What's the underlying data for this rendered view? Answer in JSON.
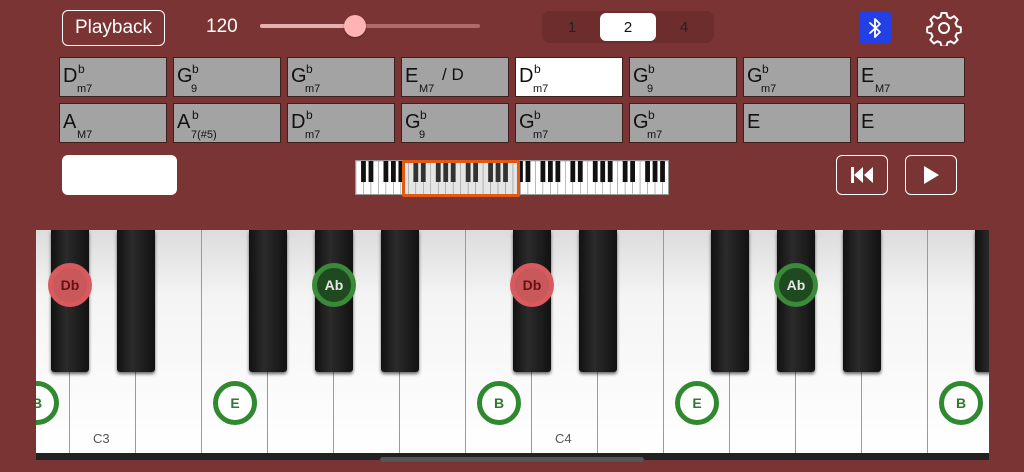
{
  "toolbar": {
    "playback_label": "Playback",
    "tempo_value": "120",
    "tempo_fraction": 0.43,
    "segments": [
      "1",
      "2",
      "4"
    ],
    "active_segment": 1
  },
  "colors": {
    "background": "#7b3434",
    "chord_cell": "#a3a3a3",
    "chord_selected": "#ffffff",
    "bluetooth": "#2340e6",
    "range_highlight": "#e05a13",
    "note_red": "#d85a5e",
    "note_green": "#2f8a2f"
  },
  "icons": {
    "bluetooth": "bluetooth-icon",
    "settings": "gear-icon",
    "rewind": "skip-back-icon",
    "play": "play-icon"
  },
  "chords": [
    {
      "root": "D",
      "acc": "b",
      "qual": "m7",
      "bass": "",
      "selected": false
    },
    {
      "root": "G",
      "acc": "b",
      "qual": "9",
      "bass": "",
      "selected": false
    },
    {
      "root": "G",
      "acc": "b",
      "qual": "m7",
      "bass": "",
      "selected": false
    },
    {
      "root": "E",
      "acc": "",
      "qual": "M7",
      "bass": "/ D",
      "selected": false
    },
    {
      "root": "D",
      "acc": "b",
      "qual": "m7",
      "bass": "",
      "selected": true
    },
    {
      "root": "G",
      "acc": "b",
      "qual": "9",
      "bass": "",
      "selected": false
    },
    {
      "root": "G",
      "acc": "b",
      "qual": "m7",
      "bass": "",
      "selected": false
    },
    {
      "root": "E",
      "acc": "",
      "qual": "M7",
      "bass": "",
      "selected": false
    },
    {
      "root": "A",
      "acc": "",
      "qual": "M7",
      "bass": "",
      "selected": false
    },
    {
      "root": "A",
      "acc": "b",
      "qual": "7(#5)",
      "bass": "",
      "selected": false
    },
    {
      "root": "D",
      "acc": "b",
      "qual": "m7",
      "bass": "",
      "selected": false
    },
    {
      "root": "G",
      "acc": "b",
      "qual": "9",
      "bass": "",
      "selected": false
    },
    {
      "root": "G",
      "acc": "b",
      "qual": "m7",
      "bass": "",
      "selected": false
    },
    {
      "root": "G",
      "acc": "b",
      "qual": "m7",
      "bass": "",
      "selected": false
    },
    {
      "root": "E",
      "acc": "",
      "qual": "",
      "bass": "",
      "selected": false
    },
    {
      "root": "E",
      "acc": "",
      "qual": "",
      "bass": "",
      "selected": false
    }
  ],
  "keyboard": {
    "octave_labels": [
      "C3",
      "C4"
    ],
    "notes": [
      {
        "label": "B",
        "white_index": 0,
        "style": "green-on-white"
      },
      {
        "label": "E",
        "white_index": 3,
        "style": "green-on-white"
      },
      {
        "label": "B",
        "white_index": 7,
        "style": "green-on-white"
      },
      {
        "label": "E",
        "white_index": 10,
        "style": "green-on-white"
      },
      {
        "label": "B",
        "white_index": 14,
        "style": "green-on-white"
      },
      {
        "label": "Db",
        "black_index": 0,
        "style": "red"
      },
      {
        "label": "Ab",
        "black_index": 3,
        "style": "green-on-black"
      },
      {
        "label": "Db",
        "black_index": 5,
        "style": "red"
      },
      {
        "label": "Ab",
        "black_index": 8,
        "style": "green-on-black"
      }
    ]
  }
}
